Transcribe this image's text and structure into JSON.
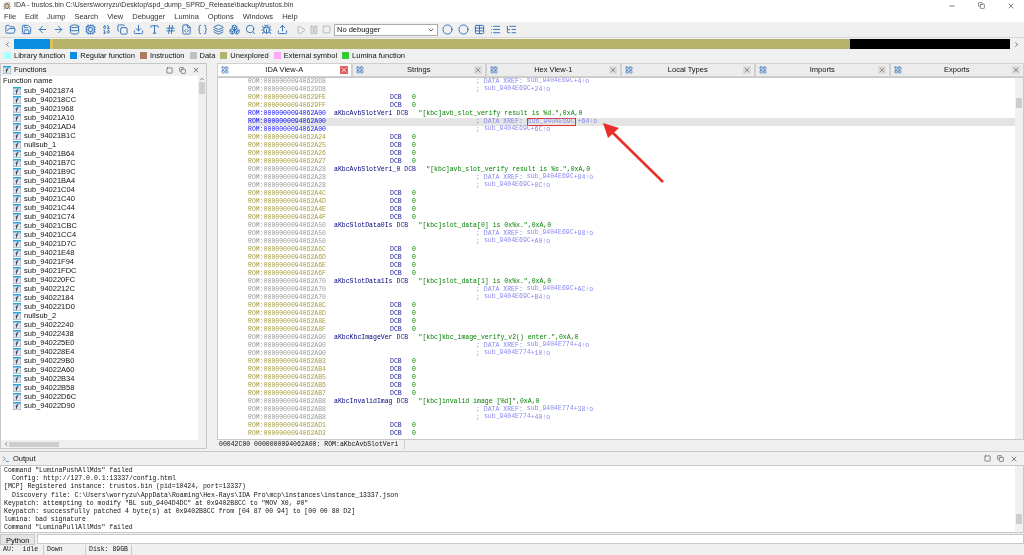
{
  "window": {
    "title": "IDA - trustos.bin C:\\Users\\worryzu\\Desktop\\spd_dump_SPRD_Release\\backup\\trustos.bin"
  },
  "menu": [
    "File",
    "Edit",
    "Jump",
    "Search",
    "View",
    "Debugger",
    "Lumina",
    "Options",
    "Windows",
    "Help"
  ],
  "toolbar": {
    "debugger": "No debugger"
  },
  "legend": [
    {
      "label": "Library function",
      "color": "#aaffff"
    },
    {
      "label": "Regular function",
      "color": "#0a8ee0"
    },
    {
      "label": "Instruction",
      "color": "#b07a5c"
    },
    {
      "label": "Data",
      "color": "#c0c0c0"
    },
    {
      "label": "Unexplored",
      "color": "#b5b36a"
    },
    {
      "label": "External symbol",
      "color": "#ffa8ff"
    },
    {
      "label": "Lumina function",
      "color": "#33cc33"
    }
  ],
  "functions": {
    "title": "Functions",
    "column": "Function name",
    "items": [
      "sub_94021874",
      "sub_940218CC",
      "sub_94021968",
      "sub_94021A10",
      "sub_94021AD4",
      "sub_94021B1C",
      "nullsub_1",
      "sub_94021B64",
      "sub_94021B7C",
      "sub_94021B9C",
      "sub_94021BA4",
      "sub_94021C04",
      "sub_94021C40",
      "sub_94021C44",
      "sub_94021C74",
      "sub_94021CBC",
      "sub_94021CC4",
      "sub_94021D7C",
      "sub_94021E48",
      "sub_94021F94",
      "sub_94021FDC",
      "sub_940220FC",
      "sub_9402212C",
      "sub_94022184",
      "sub_940221D0",
      "nullsub_2",
      "sub_94022240",
      "sub_94022438",
      "sub_940225E0",
      "sub_940228E4",
      "sub_940229B0",
      "sub_94022A60",
      "sub_94022B34",
      "sub_94022B58",
      "sub_94022D6C",
      "sub_94022D90"
    ]
  },
  "tabs": [
    {
      "label": "IDA View-A",
      "selected": true
    },
    {
      "label": "Strings",
      "selected": false
    },
    {
      "label": "Hex View-1",
      "selected": false
    },
    {
      "label": "Local Types",
      "selected": false
    },
    {
      "label": "Imports",
      "selected": false
    },
    {
      "label": "Exports",
      "selected": false
    }
  ],
  "listing": {
    "lines": [
      {
        "kind": "xref",
        "addr": "ROM:00000000940629D8",
        "prefix": "; DATA XREF:",
        "target": "sub_9404E69C",
        "offset": "+4↑o",
        "current": false,
        "selected": false,
        "marked": false
      },
      {
        "kind": "xref",
        "addr": "ROM:00000000940629D8",
        "prefix": ";",
        "target": "sub_9404E69C",
        "offset": "+24↑o",
        "current": false,
        "selected": false,
        "marked": false
      },
      {
        "kind": "data",
        "addr": "ROM:00000000940629FE",
        "op": "DCB",
        "value": "0",
        "current": false,
        "selected": false
      },
      {
        "kind": "data",
        "addr": "ROM:00000000940629FF",
        "op": "DCB",
        "value": "0",
        "current": false,
        "selected": false
      },
      {
        "kind": "string",
        "addr": "ROM:0000000094062A00",
        "label": "aKbcAvbSlotVeri",
        "op": "DCB",
        "value": "\"[kbc]avb_slot_verify result is %d.\",0xA,0",
        "current": true,
        "selected": false
      },
      {
        "kind": "xref",
        "addr": "ROM:0000000094062A00",
        "prefix": "; DATA XREF:",
        "target": "sub_9404E69C",
        "offset": "+64↑o",
        "current": true,
        "selected": true,
        "marked": true
      },
      {
        "kind": "xref",
        "addr": "ROM:0000000094062A00",
        "prefix": ";",
        "target": "sub_9404E69C",
        "offset": "+6C↑o",
        "current": true,
        "selected": false,
        "marked": false
      },
      {
        "kind": "data",
        "addr": "ROM:0000000094062A24",
        "op": "DCB",
        "value": "0",
        "current": false,
        "selected": false
      },
      {
        "kind": "data",
        "addr": "ROM:0000000094062A25",
        "op": "DCB",
        "value": "0",
        "current": false,
        "selected": false
      },
      {
        "kind": "data",
        "addr": "ROM:0000000094062A26",
        "op": "DCB",
        "value": "0",
        "current": false,
        "selected": false
      },
      {
        "kind": "data",
        "addr": "ROM:0000000094062A27",
        "op": "DCB",
        "value": "0",
        "current": false,
        "selected": false
      },
      {
        "kind": "string",
        "addr": "ROM:0000000094062A28",
        "label": "aKbcAvbSlotVeri_0",
        "op": "DCB",
        "value": "\"[kbc]avb_slot_verify result is %s.\",0xA,0",
        "current": false,
        "selected": false
      },
      {
        "kind": "xref",
        "addr": "ROM:0000000094062A28",
        "prefix": "; DATA XREF:",
        "target": "sub_9404E69C",
        "offset": "+84↑o",
        "current": false,
        "selected": false,
        "marked": false
      },
      {
        "kind": "xref",
        "addr": "ROM:0000000094062A28",
        "prefix": ";",
        "target": "sub_9404E69C",
        "offset": "+8C↑o",
        "current": false,
        "selected": false,
        "marked": false
      },
      {
        "kind": "data",
        "addr": "ROM:0000000094062A4C",
        "op": "DCB",
        "value": "0",
        "current": false,
        "selected": false
      },
      {
        "kind": "data",
        "addr": "ROM:0000000094062A4D",
        "op": "DCB",
        "value": "0",
        "current": false,
        "selected": false
      },
      {
        "kind": "data",
        "addr": "ROM:0000000094062A4E",
        "op": "DCB",
        "value": "0",
        "current": false,
        "selected": false
      },
      {
        "kind": "data",
        "addr": "ROM:0000000094062A4F",
        "op": "DCB",
        "value": "0",
        "current": false,
        "selected": false
      },
      {
        "kind": "string",
        "addr": "ROM:0000000094062A50",
        "label": "aKbcSlotData0Is",
        "op": "DCB",
        "value": "\"[kbc]slot_data[0] is 0x%x.\",0xA,0",
        "current": false,
        "selected": false
      },
      {
        "kind": "xref",
        "addr": "ROM:0000000094062A50",
        "prefix": "; DATA XREF:",
        "target": "sub_9404E69C",
        "offset": "+98↑o",
        "current": false,
        "selected": false,
        "marked": false
      },
      {
        "kind": "xref",
        "addr": "ROM:0000000094062A50",
        "prefix": ";",
        "target": "sub_9404E69C",
        "offset": "+A0↑o",
        "current": false,
        "selected": false,
        "marked": false
      },
      {
        "kind": "data",
        "addr": "ROM:0000000094062A6C",
        "op": "DCB",
        "value": "0",
        "current": false,
        "selected": false
      },
      {
        "kind": "data",
        "addr": "ROM:0000000094062A6D",
        "op": "DCB",
        "value": "0",
        "current": false,
        "selected": false
      },
      {
        "kind": "data",
        "addr": "ROM:0000000094062A6E",
        "op": "DCB",
        "value": "0",
        "current": false,
        "selected": false
      },
      {
        "kind": "data",
        "addr": "ROM:0000000094062A6F",
        "op": "DCB",
        "value": "0",
        "current": false,
        "selected": false
      },
      {
        "kind": "string",
        "addr": "ROM:0000000094062A70",
        "label": "aKbcSlotData1Is",
        "op": "DCB",
        "value": "\"[kbc]slot_data[1] is 0x%x.\",0xA,0",
        "current": false,
        "selected": false
      },
      {
        "kind": "xref",
        "addr": "ROM:0000000094062A70",
        "prefix": "; DATA XREF:",
        "target": "sub_9404E69C",
        "offset": "+AC↑o",
        "current": false,
        "selected": false,
        "marked": false
      },
      {
        "kind": "xref",
        "addr": "ROM:0000000094062A70",
        "prefix": ";",
        "target": "sub_9404E69C",
        "offset": "+B4↑o",
        "current": false,
        "selected": false,
        "marked": false
      },
      {
        "kind": "data",
        "addr": "ROM:0000000094062A8C",
        "op": "DCB",
        "value": "0",
        "current": false,
        "selected": false
      },
      {
        "kind": "data",
        "addr": "ROM:0000000094062A8D",
        "op": "DCB",
        "value": "0",
        "current": false,
        "selected": false
      },
      {
        "kind": "data",
        "addr": "ROM:0000000094062A8E",
        "op": "DCB",
        "value": "0",
        "current": false,
        "selected": false
      },
      {
        "kind": "data",
        "addr": "ROM:0000000094062A8F",
        "op": "DCB",
        "value": "0",
        "current": false,
        "selected": false
      },
      {
        "kind": "string",
        "addr": "ROM:0000000094062A90",
        "label": "aKbcKbcImageVer",
        "op": "DCB",
        "value": "\"[kbc]kbc_image_verify_v2() enter.\",0xA,0",
        "current": false,
        "selected": false
      },
      {
        "kind": "xref",
        "addr": "ROM:0000000094062A90",
        "prefix": "; DATA XREF:",
        "target": "sub_9404E774",
        "offset": "+4↑o",
        "current": false,
        "selected": false,
        "marked": false
      },
      {
        "kind": "xref",
        "addr": "ROM:0000000094062A90",
        "prefix": ";",
        "target": "sub_9404E774",
        "offset": "+10↑o",
        "current": false,
        "selected": false,
        "marked": false
      },
      {
        "kind": "data",
        "addr": "ROM:0000000094062AB3",
        "op": "DCB",
        "value": "0",
        "current": false,
        "selected": false
      },
      {
        "kind": "data",
        "addr": "ROM:0000000094062AB4",
        "op": "DCB",
        "value": "0",
        "current": false,
        "selected": false
      },
      {
        "kind": "data",
        "addr": "ROM:0000000094062AB5",
        "op": "DCB",
        "value": "0",
        "current": false,
        "selected": false
      },
      {
        "kind": "data",
        "addr": "ROM:0000000094062AB6",
        "op": "DCB",
        "value": "0",
        "current": false,
        "selected": false
      },
      {
        "kind": "data",
        "addr": "ROM:0000000094062AB7",
        "op": "DCB",
        "value": "0",
        "current": false,
        "selected": false
      },
      {
        "kind": "string",
        "addr": "ROM:0000000094062AB8",
        "label": "aKbcInvalidImag",
        "op": "DCB",
        "value": "\"[kbc]invalid image [%d]\",0xA,0",
        "current": false,
        "selected": false
      },
      {
        "kind": "xref",
        "addr": "ROM:0000000094062AB8",
        "prefix": "; DATA XREF:",
        "target": "sub_9404E774",
        "offset": "+38↑o",
        "current": false,
        "selected": false,
        "marked": false
      },
      {
        "kind": "xref",
        "addr": "ROM:0000000094062AB8",
        "prefix": ";",
        "target": "sub_9404E774",
        "offset": "+40↑o",
        "current": false,
        "selected": false,
        "marked": false
      },
      {
        "kind": "data",
        "addr": "ROM:0000000094062AD1",
        "op": "DCB",
        "value": "0",
        "current": false,
        "selected": false
      },
      {
        "kind": "data",
        "addr": "ROM:0000000094062AD2",
        "op": "DCB",
        "value": "0",
        "current": false,
        "selected": false
      }
    ],
    "status": "00042C00 0000000094062A00: ROM:aKbcAvbSlotVeri"
  },
  "output": {
    "title": "Output",
    "lines": [
      {
        "text": "Command \"LuminaPushAllMds\" failed",
        "indented": false
      },
      {
        "text": "Config: http://127.0.0.1:13337/config.html",
        "indented": true
      },
      {
        "text": "[MCP] Registered instance: trustos.bin (pid=10424, port=13337)",
        "indented": false
      },
      {
        "text": "Discovery file: C:\\Users\\worryzu\\AppData\\Roaming\\Hex-Rays\\IDA Pro\\mcp\\instances\\instance_13337.json",
        "indented": true
      },
      {
        "text": "Keypatch: attempting to modify \"BL sub_9404D4DC\" at 0x9402B8CC to \"MOV X0, #0\"",
        "indented": false
      },
      {
        "text": "Keypatch: successfully patched 4 byte(s) at 0x9402B8CC from [04 87 00 94] to [00 00 80 D2]",
        "indented": false
      },
      {
        "text": "lumina: bad signature",
        "indented": false
      },
      {
        "text": "Command \"LuminaPullAllMds\" failed",
        "indented": false
      }
    ],
    "python_button": "Python"
  },
  "status_bar": [
    "AU:  idle",
    "Down",
    "Disk: 89GB"
  ]
}
